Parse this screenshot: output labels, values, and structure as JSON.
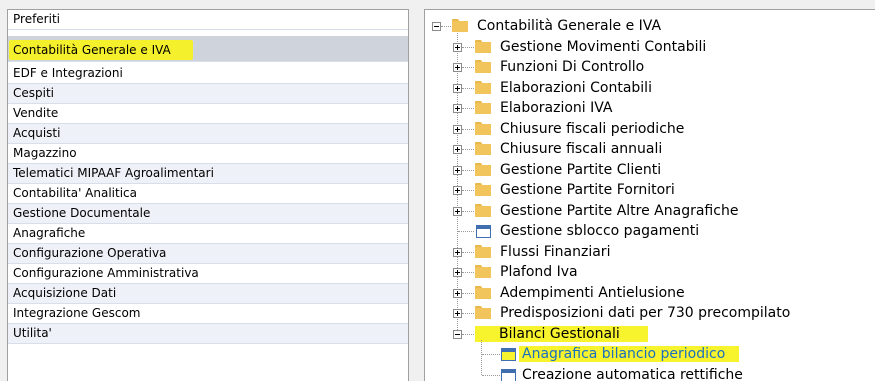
{
  "modules": [
    {
      "label": "Preferiti"
    },
    {
      "label": "Contabilità Generale e IVA",
      "selected": true
    },
    {
      "label": "EDF e Integrazioni"
    },
    {
      "label": "Cespiti"
    },
    {
      "label": "Vendite"
    },
    {
      "label": "Acquisti"
    },
    {
      "label": "Magazzino"
    },
    {
      "label": "Telematici MIPAAF Agroalimentari"
    },
    {
      "label": "Contabilita' Analitica"
    },
    {
      "label": "Gestione Documentale"
    },
    {
      "label": "Anagrafiche"
    },
    {
      "label": "Configurazione Operativa"
    },
    {
      "label": "Configurazione Amministrativa"
    },
    {
      "label": "Acquisizione Dati"
    },
    {
      "label": "Integrazione Gescom"
    },
    {
      "label": "Utilita'"
    }
  ],
  "tree": {
    "root": "Contabilità Generale e IVA",
    "nodes": [
      {
        "label": "Gestione Movimenti Contabili",
        "type": "folder",
        "expander": "plus"
      },
      {
        "label": "Funzioni Di Controllo",
        "type": "folder",
        "expander": "plus"
      },
      {
        "label": "Elaborazioni Contabili",
        "type": "folder",
        "expander": "plus"
      },
      {
        "label": "Elaborazioni IVA",
        "type": "folder",
        "expander": "plus"
      },
      {
        "label": "Chiusure fiscali periodiche",
        "type": "folder",
        "expander": "plus"
      },
      {
        "label": "Chiusure fiscali annuali",
        "type": "folder",
        "expander": "plus"
      },
      {
        "label": "Gestione Partite Clienti",
        "type": "folder",
        "expander": "plus"
      },
      {
        "label": "Gestione Partite Fornitori",
        "type": "folder",
        "expander": "plus"
      },
      {
        "label": "Gestione Partite Altre Anagrafiche",
        "type": "folder",
        "expander": "plus"
      },
      {
        "label": "Gestione sblocco pagamenti",
        "type": "form",
        "expander": "none"
      },
      {
        "label": "Flussi Finanziari",
        "type": "folder",
        "expander": "plus"
      },
      {
        "label": "Plafond Iva",
        "type": "folder",
        "expander": "plus"
      },
      {
        "label": "Adempimenti Antielusione",
        "type": "folder",
        "expander": "plus"
      },
      {
        "label": "Predisposizioni dati per 730 precompilato",
        "type": "folder",
        "expander": "plus"
      },
      {
        "label": "Bilanci Gestionali",
        "type": "folder",
        "expander": "minus",
        "highlighted": true
      }
    ],
    "children": [
      {
        "label": "Anagrafica bilancio periodico",
        "type": "form",
        "highlighted": true
      },
      {
        "label": "Creazione automatica rettifiche",
        "type": "form"
      }
    ]
  },
  "colors": {
    "highlight": "#f5f02c",
    "selected_row": "#cfd4dc",
    "alt_row": "#eef1f7",
    "folder": "#f2c55c"
  }
}
